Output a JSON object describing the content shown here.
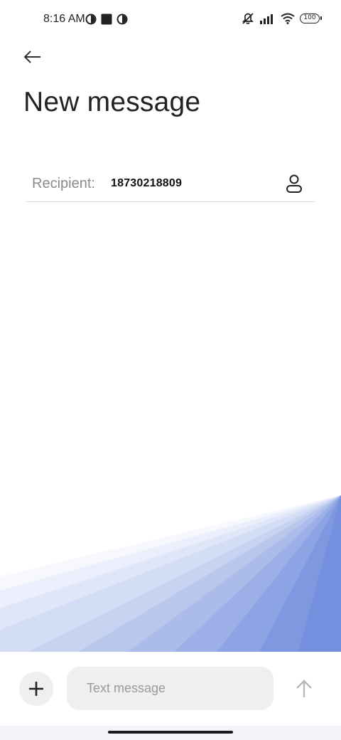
{
  "status_bar": {
    "time": "8:16 AM",
    "battery_level": "100",
    "left_icons": [
      "data-saver-icon",
      "square-notification-icon",
      "data-saver-icon"
    ],
    "right_icons": [
      "vibrate-off-icon",
      "signal-icon",
      "wifi-icon",
      "battery-icon"
    ]
  },
  "header": {
    "back_icon": "arrow-left-icon",
    "title": "New message"
  },
  "recipient": {
    "label": "Recipient:",
    "value": "18730218809",
    "contact_icon": "person-icon"
  },
  "composer": {
    "attach_icon": "plus-icon",
    "placeholder": "Text message",
    "value": "",
    "send_icon": "arrow-up-icon"
  },
  "colors": {
    "accent": "#4a6ed6",
    "text_primary": "#222222",
    "text_secondary": "#8a8a8a",
    "input_background": "#efefef"
  }
}
